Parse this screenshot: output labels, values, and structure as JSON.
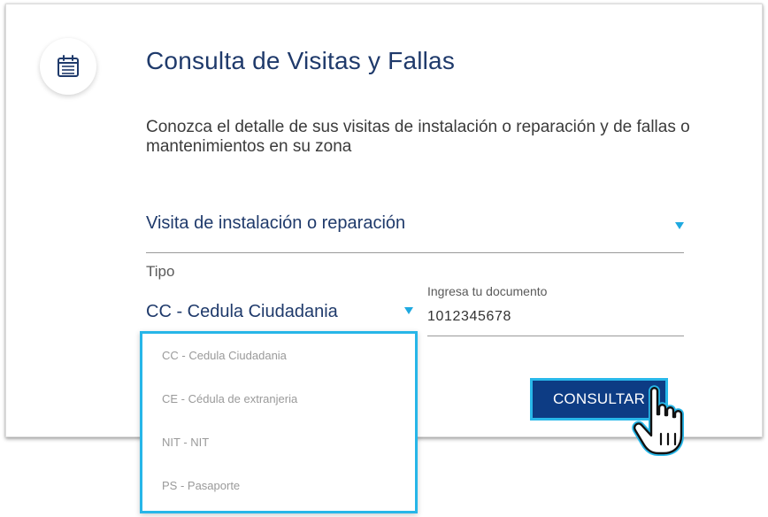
{
  "header": {
    "title": "Consulta de Visitas y Fallas",
    "icon": "calendar-icon"
  },
  "description": "Conozca el detalle de sus visitas de instalación o reparación y de fallas o mantenimientos en su zona",
  "visit_type_select": {
    "value": "Visita de instalación o reparación"
  },
  "document_type": {
    "label": "Tipo",
    "value": "CC - Cedula Ciudadania",
    "options": [
      "CC - Cedula Ciudadania",
      "CE - Cédula de extranjeria",
      "NIT - NIT",
      "PS - Pasaporte"
    ]
  },
  "document_input": {
    "label": "Ingresa tu documento",
    "value": "1012345678"
  },
  "consult_button": {
    "label": "CONSULTAR"
  },
  "colors": {
    "primary_navy": "#0d3c84",
    "title_blue": "#1f3a6b",
    "accent_cyan": "#27b6e8"
  }
}
